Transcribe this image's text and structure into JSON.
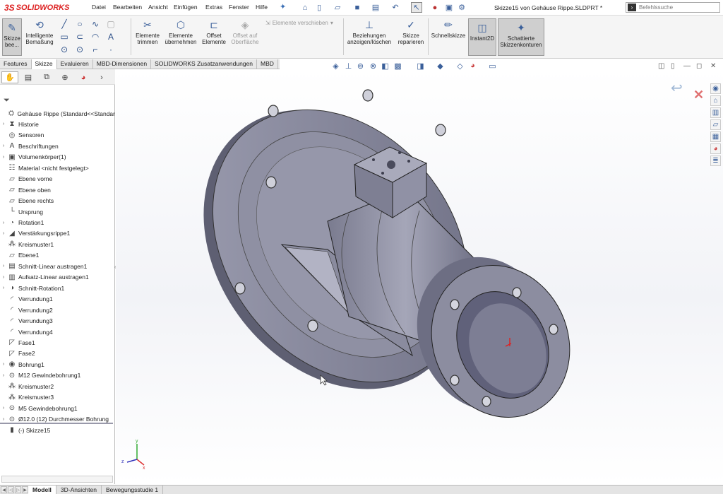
{
  "app": {
    "brand_prefix": "3S",
    "brand": "SOLIDWORKS"
  },
  "menu": [
    "Datei",
    "Bearbeiten",
    "Ansicht",
    "Einfügen",
    "Extras",
    "Fenster",
    "Hilfe"
  ],
  "document_title": "Skizze15 von Gehäuse Rippe.SLDPRT *",
  "search": {
    "placeholder": "Befehlssuche"
  },
  "ribbon": {
    "sketch_label": "Skizze bee...",
    "smart_dim_label": "Intelligente Bemaßung",
    "trim_label": "Elemente trimmen",
    "convert_label": "Elemente übernehmen",
    "offset_label": "Offset Elemente",
    "offset_surface_label": "Offset auf Oberfläche",
    "move_label": "Elemente verschieben",
    "relations_label": "Beziehungen anzeigen/löschen",
    "repair_label": "Skizze reparieren",
    "quick_label": "Schnellskizze",
    "instant_label": "Instant2D",
    "shaded_label": "Schattierte Skizzenkonturen"
  },
  "tabs": [
    {
      "label": "Features",
      "active": false
    },
    {
      "label": "Skizze",
      "active": true
    },
    {
      "label": "Evaluieren",
      "active": false
    },
    {
      "label": "MBD-Dimensionen",
      "active": false
    },
    {
      "label": "SOLIDWORKS Zusatzanwendungen",
      "active": false
    },
    {
      "label": "MBD",
      "active": false
    }
  ],
  "tree": [
    {
      "label": "Gehäuse Rippe  (Standard<<Standar",
      "icon": "part-icon",
      "arrow": ""
    },
    {
      "label": "Historie",
      "icon": "history-icon",
      "arrow": "›"
    },
    {
      "label": "Sensoren",
      "icon": "sensor-icon",
      "arrow": ""
    },
    {
      "label": "Beschriftungen",
      "icon": "annotation-icon",
      "arrow": "›"
    },
    {
      "label": "Volumenkörper(1)",
      "icon": "solid-bodies-icon",
      "arrow": "›"
    },
    {
      "label": "Material <nicht festgelegt>",
      "icon": "material-icon",
      "arrow": ""
    },
    {
      "label": "Ebene vorne",
      "icon": "plane-icon",
      "arrow": ""
    },
    {
      "label": "Ebene oben",
      "icon": "plane-icon",
      "arrow": ""
    },
    {
      "label": "Ebene rechts",
      "icon": "plane-icon",
      "arrow": ""
    },
    {
      "label": "Ursprung",
      "icon": "origin-icon",
      "arrow": ""
    },
    {
      "label": "Rotation1",
      "icon": "revolve-icon",
      "arrow": "›"
    },
    {
      "label": "Verstärkungsrippe1",
      "icon": "rib-icon",
      "arrow": "›"
    },
    {
      "label": "Kreismuster1",
      "icon": "circular-pattern-icon",
      "arrow": ""
    },
    {
      "label": "Ebene1",
      "icon": "plane-icon",
      "arrow": ""
    },
    {
      "label": "Schnitt-Linear austragen1",
      "icon": "cut-extrude-icon",
      "arrow": "›"
    },
    {
      "label": "Aufsatz-Linear austragen1",
      "icon": "boss-extrude-icon",
      "arrow": "›"
    },
    {
      "label": "Schnitt-Rotation1",
      "icon": "cut-revolve-icon",
      "arrow": "›"
    },
    {
      "label": "Verrundung1",
      "icon": "fillet-icon",
      "arrow": ""
    },
    {
      "label": "Verrundung2",
      "icon": "fillet-icon",
      "arrow": ""
    },
    {
      "label": "Verrundung3",
      "icon": "fillet-icon",
      "arrow": ""
    },
    {
      "label": "Verrundung4",
      "icon": "fillet-icon",
      "arrow": ""
    },
    {
      "label": "Fase1",
      "icon": "chamfer-icon",
      "arrow": ""
    },
    {
      "label": "Fase2",
      "icon": "chamfer-icon",
      "arrow": ""
    },
    {
      "label": "Bohrung1",
      "icon": "hole-icon",
      "arrow": "›"
    },
    {
      "label": "M12 Gewindebohrung1",
      "icon": "hole-wizard-icon",
      "arrow": "›"
    },
    {
      "label": "Kreismuster2",
      "icon": "circular-pattern-icon",
      "arrow": ""
    },
    {
      "label": "Kreismuster3",
      "icon": "circular-pattern-icon",
      "arrow": ""
    },
    {
      "label": "M5 Gewindebohrung1",
      "icon": "hole-wizard-icon",
      "arrow": "›"
    },
    {
      "label": "Ø12.0 (12) Durchmesser Bohrung",
      "icon": "hole-wizard-icon",
      "arrow": "›"
    },
    {
      "label": "(-) Skizze15",
      "icon": "sketch-icon",
      "arrow": ""
    }
  ],
  "bottom_tabs": [
    {
      "label": "Modell",
      "active": true
    },
    {
      "label": "3D-Ansichten",
      "active": false
    },
    {
      "label": "Bewegungsstudie 1",
      "active": false
    }
  ],
  "colors": {
    "accent": "#3a5f9a",
    "brand": "#d22222",
    "model": "#8e8fa0"
  }
}
